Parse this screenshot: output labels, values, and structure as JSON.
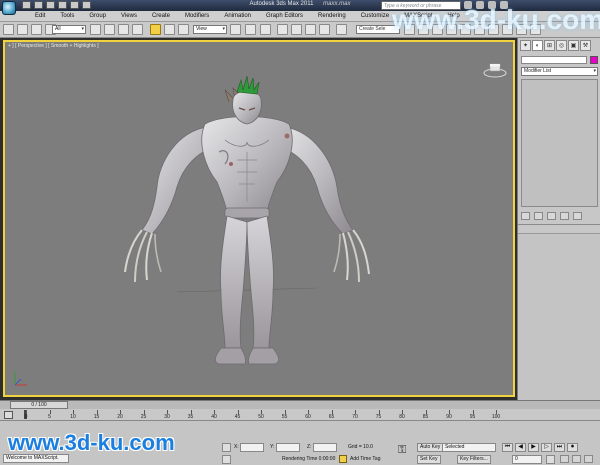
{
  "titlebar": {
    "app_title": "Autodesk 3ds Max 2011",
    "file_name": "maxx.max",
    "search_placeholder": "Type a keyword or phrase"
  },
  "menubar": {
    "items": [
      "Edit",
      "Tools",
      "Group",
      "Views",
      "Create",
      "Modifiers",
      "Animation",
      "Graph Editors",
      "Rendering",
      "Customize",
      "MAXScript",
      "Help"
    ]
  },
  "toolbar": {
    "selection_filter": "All",
    "reference_coord": "View",
    "named_selection": "Create Sele"
  },
  "viewport": {
    "label": "+ ] [ Perspective ] [ Smooth + Highlights ]"
  },
  "command_panel": {
    "modifier_list_label": "Modifier List",
    "object_color": "#e800c8",
    "tabs": [
      "create",
      "modify",
      "hierarchy",
      "motion",
      "display",
      "utilities"
    ]
  },
  "timeline": {
    "frame_display": "0 / 100",
    "tick_labels": [
      "0",
      "5",
      "10",
      "15",
      "20",
      "25",
      "30",
      "35",
      "40",
      "45",
      "50",
      "55",
      "60",
      "65",
      "70",
      "75",
      "80",
      "85",
      "90",
      "95",
      "100"
    ]
  },
  "statusbar": {
    "welcome_text": "Welcome to MAXScript.",
    "x_label": "X:",
    "y_label": "Y:",
    "z_label": "Z:",
    "grid_text": "Grid = 10.0",
    "auto_key_label": "Auto Key",
    "key_mode_value": "Selected",
    "set_key_label": "Set Key",
    "key_filters_label": "Key Filters...",
    "rendering_time": "Rendering Time  0:00:00",
    "add_time_tag": "Add Time Tag",
    "frame_field": "0"
  },
  "watermark": {
    "top": "www.3d-ku.com",
    "bottom": "www.3d-ku.com"
  }
}
